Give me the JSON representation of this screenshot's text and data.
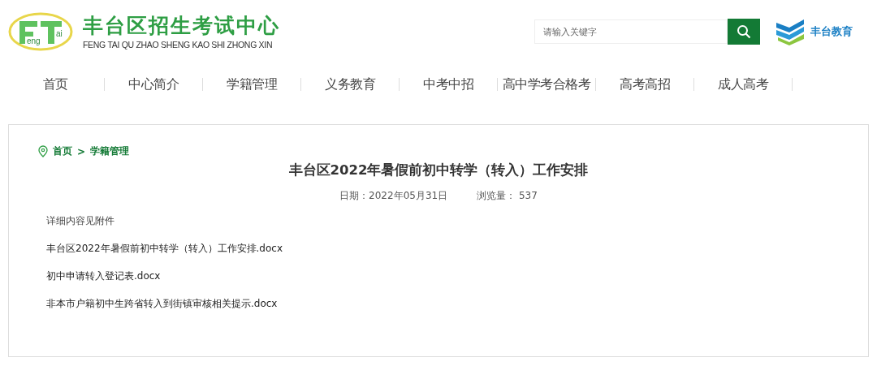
{
  "header": {
    "logo_letters": [
      "eng",
      "ai"
    ],
    "site_title": "丰台区招生考试中心",
    "site_subtitle": "FENG TAI QU ZHAO SHENG KAO SHI ZHONG XIN",
    "search": {
      "placeholder": "请输入关键字"
    },
    "partner_name": "丰台教育"
  },
  "nav": [
    {
      "label": "首页"
    },
    {
      "label": "中心简介"
    },
    {
      "label": "学籍管理"
    },
    {
      "label": "义务教育"
    },
    {
      "label": "中考中招"
    },
    {
      "label": "高中学考合格考"
    },
    {
      "label": "高考高招"
    },
    {
      "label": "成人高考"
    }
  ],
  "breadcrumb": [
    "首页",
    "学籍管理"
  ],
  "breadcrumb_separator": ">",
  "article": {
    "title": "丰台区2022年暑假前初中转学（转入）工作安排",
    "date_label": "日期：",
    "date": "2022年05月31日",
    "views_label": "浏览量：",
    "views": "537",
    "body": [
      {
        "kind": "text",
        "text": "详细内容见附件"
      },
      {
        "kind": "attachment",
        "text": "丰台区2022年暑假前初中转学（转入）工作安排.docx"
      },
      {
        "kind": "attachment",
        "text": "初中申请转入登记表.docx"
      },
      {
        "kind": "attachment",
        "text": "非本市户籍初中生跨省转入到街镇审核相关提示.docx"
      }
    ]
  }
}
